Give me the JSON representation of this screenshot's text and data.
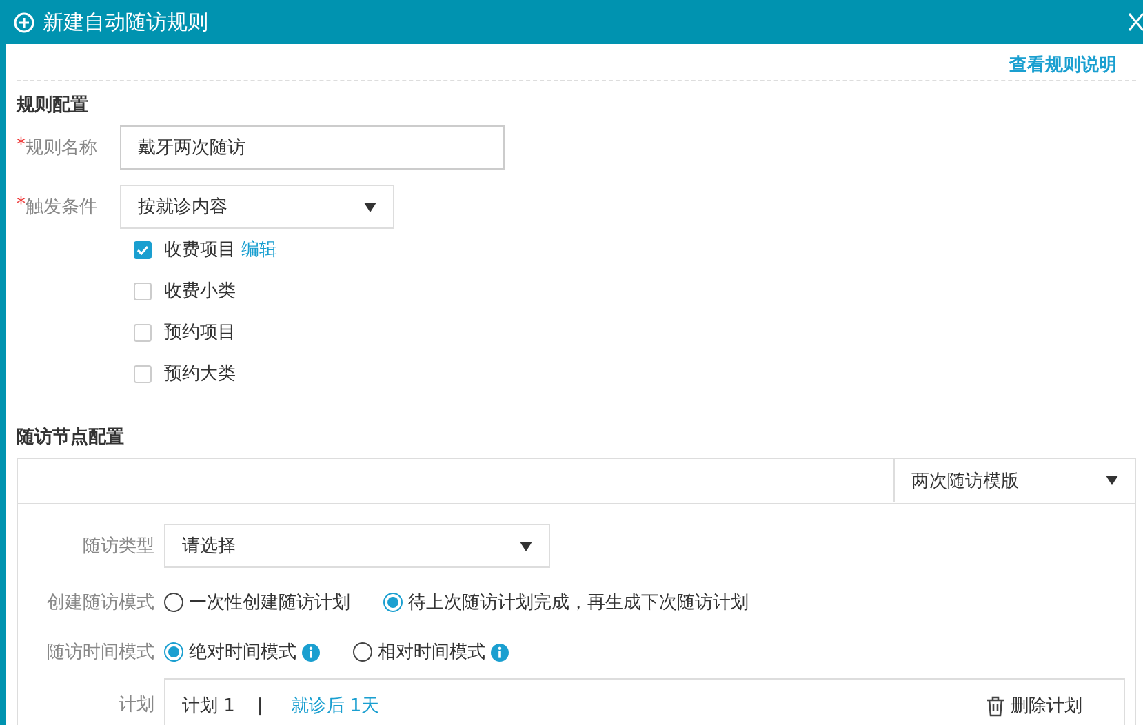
{
  "window": {
    "title": "新建自动随访规则"
  },
  "help_link": "查看规则说明",
  "rule_config": {
    "heading": "规则配置",
    "name_field": {
      "marker": "*",
      "label": "规则名称",
      "value": "戴牙两次随访"
    },
    "trigger": {
      "marker": "*",
      "label": "触发条件",
      "value": "按就诊内容"
    },
    "options": [
      {
        "label": "收费项目",
        "checked": true,
        "link": "编辑"
      },
      {
        "label": "收费小类",
        "checked": false
      },
      {
        "label": "预约项目",
        "checked": false
      },
      {
        "label": "预约大类",
        "checked": false
      }
    ]
  },
  "node_config": {
    "heading": "随访节点配置",
    "template": "两次随访模版",
    "type": {
      "label": "随访类型",
      "value": "请选择"
    },
    "create_mode": {
      "label": "创建随访模式",
      "options": [
        {
          "label": "一次性创建随访计划",
          "selected": false,
          "info": false
        },
        {
          "label": "待上次随访计划完成，再生成下次随访计划",
          "selected": true,
          "info": false
        }
      ]
    },
    "time_mode": {
      "label": "随访时间模式",
      "options": [
        {
          "label": "绝对时间模式",
          "selected": true,
          "info": true
        },
        {
          "label": "相对时间模式",
          "selected": false,
          "info": true
        }
      ]
    },
    "plan": {
      "label": "计划",
      "name": "计划 1",
      "separator": "|",
      "timing": "就诊后 1天",
      "delete": "删除计划"
    }
  }
}
